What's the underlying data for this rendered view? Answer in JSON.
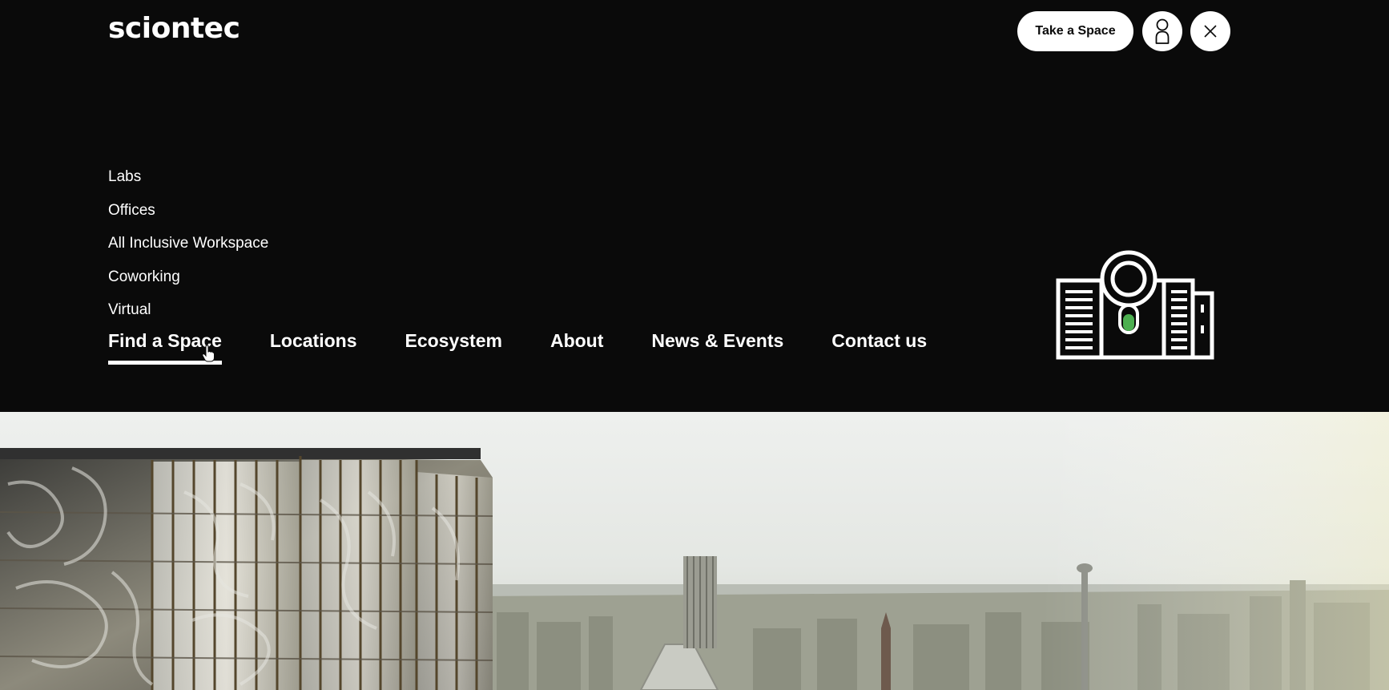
{
  "brand": {
    "logo_text": "sciontec"
  },
  "header": {
    "cta_label": "Take a Space",
    "account_icon": "user-icon",
    "close_icon": "close-icon"
  },
  "submenu": {
    "items": [
      {
        "label": "Labs"
      },
      {
        "label": "Offices"
      },
      {
        "label": "All Inclusive Workspace"
      },
      {
        "label": "Coworking"
      },
      {
        "label": "Virtual"
      }
    ]
  },
  "main_nav": {
    "items": [
      {
        "label": "Find a Space",
        "active": true
      },
      {
        "label": "Locations"
      },
      {
        "label": "Ecosystem"
      },
      {
        "label": "About"
      },
      {
        "label": "News & Events"
      },
      {
        "label": "Contact us"
      }
    ]
  },
  "illustration": {
    "icon": "lab-buildings-search-icon",
    "accent_color": "#4caf50"
  },
  "colors": {
    "background": "#0a0a0a",
    "text": "#ffffff",
    "button_bg": "#ffffff"
  }
}
